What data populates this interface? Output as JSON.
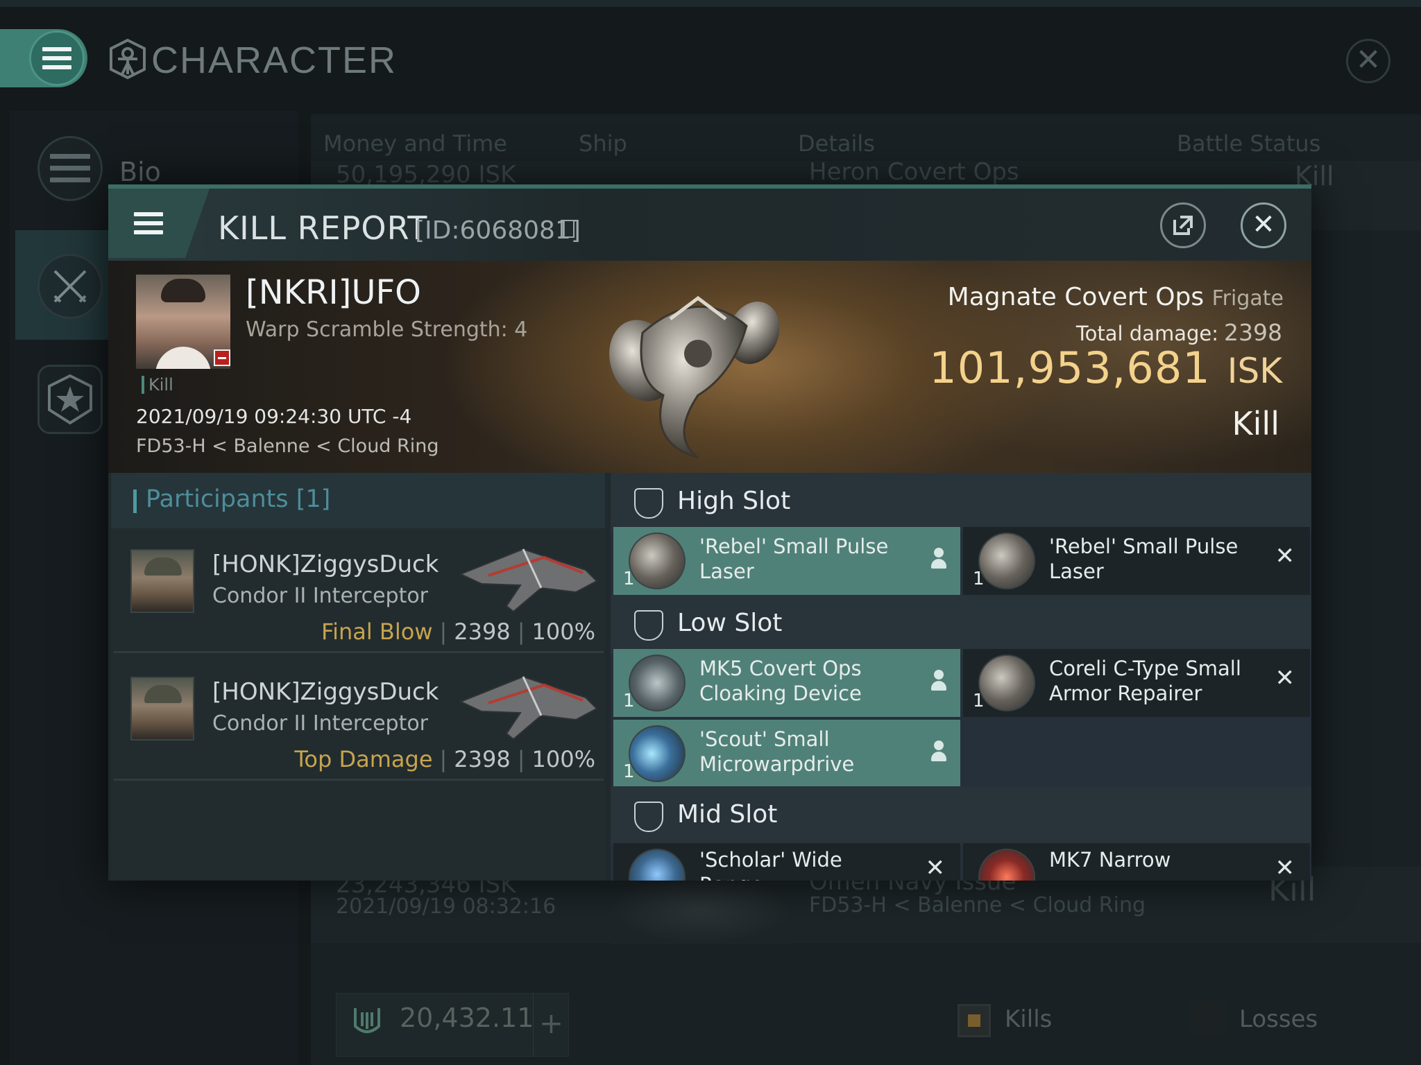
{
  "app": {
    "title": "CHARACTER",
    "icons": {
      "menu": "hamburger-icon",
      "character": "character-emblem-icon",
      "close": "close-icon"
    }
  },
  "sidebar": {
    "items": [
      {
        "label": "Bio",
        "icon": "bio-menu-icon"
      },
      {
        "label": "",
        "icon": "crossed-swords-icon",
        "active": true
      },
      {
        "label": "",
        "icon": "star-shield-icon"
      }
    ]
  },
  "background_list": {
    "columns": [
      "Money and Time",
      "Ship",
      "Details",
      "Battle Status"
    ],
    "rows": [
      {
        "isk": "50,195,290 ISK",
        "ship": "Heron Covert Ops",
        "status": "Kill"
      },
      {
        "isk": "23,243,346 ISK",
        "date": "2021/09/19  08:32:16",
        "ship": "Omen Navy Issue",
        "location": "FD53-H < Balenne < Cloud Ring",
        "status": "Kill"
      }
    ],
    "wallet": {
      "value": "20,432.11",
      "plus": "+"
    },
    "filters": {
      "kills": "Kills",
      "losses": "Losses"
    }
  },
  "kill_report": {
    "title": "KILL REPORT",
    "id": "[ID:6068081]",
    "victim": {
      "name": "[NKRI]UFO",
      "warp_scramble": "Warp Scramble Strength: 4",
      "tag": "Kill",
      "time": "2021/09/19 09:24:30 UTC -4",
      "location": "FD53-H < Balenne < Cloud Ring"
    },
    "ship": {
      "name": "Magnate Covert Ops",
      "class": "Frigate",
      "damage_label": "Total damage:",
      "damage": "2398",
      "isk_value": "101,953,681",
      "isk_unit": "ISK",
      "status": "Kill"
    },
    "participants": {
      "label": "Participants [1]",
      "list": [
        {
          "name": "[HONK]ZiggysDuck",
          "ship": "Condor II Interceptor",
          "role": "Final Blow",
          "damage": "2398",
          "percent": "100%"
        },
        {
          "name": "[HONK]ZiggysDuck",
          "ship": "Condor II Interceptor",
          "role": "Top Damage",
          "damage": "2398",
          "percent": "100%"
        }
      ]
    },
    "fitting": {
      "high": {
        "label": "High Slot",
        "modules": [
          {
            "qty": "1",
            "name": "'Rebel' Small Pulse Laser",
            "state": "fitted"
          },
          {
            "qty": "1",
            "name": "'Rebel' Small Pulse Laser",
            "state": "destroyed"
          }
        ]
      },
      "low": {
        "label": "Low Slot",
        "modules": [
          {
            "qty": "1",
            "name": "MK5 Covert Ops Cloaking Device",
            "state": "fitted"
          },
          {
            "qty": "1",
            "name": "Coreli C-Type Small Armor Repairer",
            "state": "destroyed"
          },
          {
            "qty": "1",
            "name": "'Scout' Small Microwarpdrive",
            "state": "fitted"
          }
        ]
      },
      "mid": {
        "label": "Mid Slot",
        "modules": [
          {
            "qty": "",
            "name": "'Scholar' Wide Range",
            "state": "destroyed"
          },
          {
            "qty": "",
            "name": "MK7 Narrow",
            "state": "destroyed"
          }
        ]
      }
    }
  },
  "colors": {
    "accent": "#3f8074",
    "active_module": "#508178",
    "isk": "#f3d28c",
    "role": "#c7a44e",
    "participants": "#4d8e9a"
  }
}
